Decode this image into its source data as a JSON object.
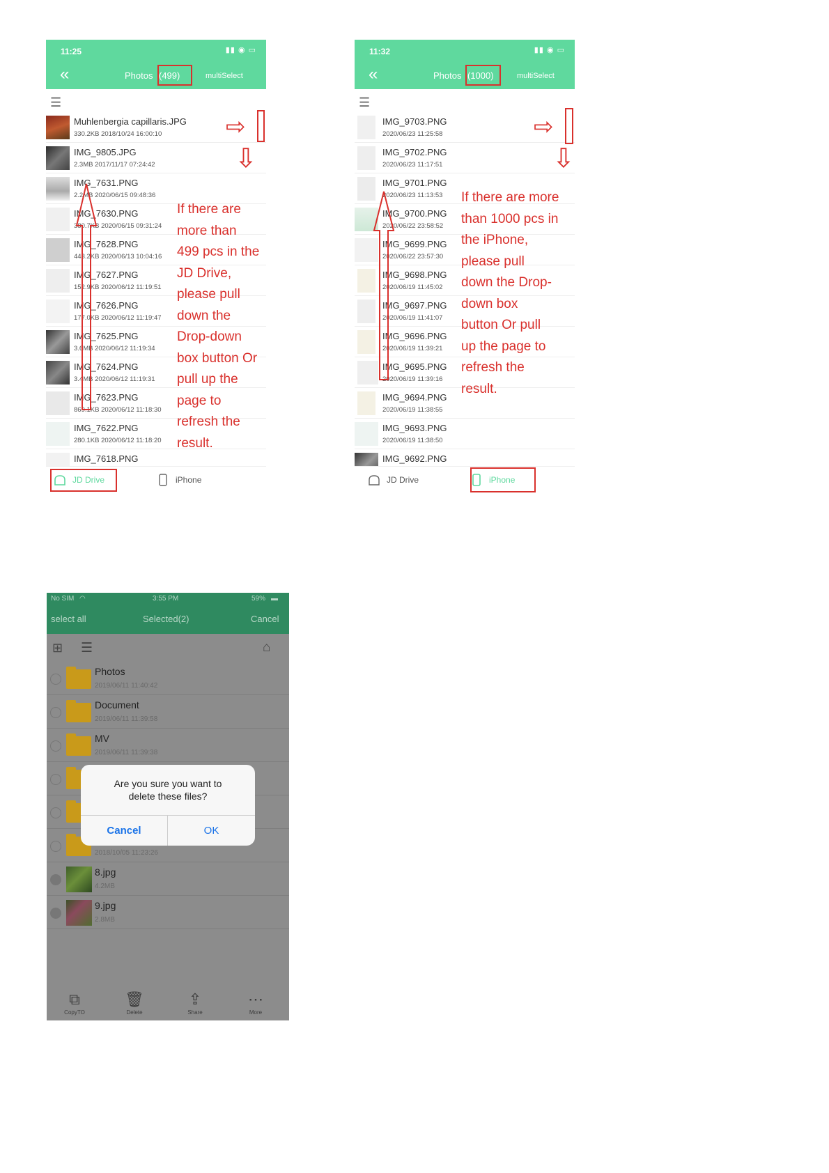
{
  "phone1": {
    "status_time": "11:25",
    "title": "Photos",
    "count": "(499)",
    "multiselect": "multiSelect",
    "files": [
      {
        "name": "Muhlenbergia capillaris.JPG",
        "meta": "330.2KB 2018/10/24 16:00:10"
      },
      {
        "name": "IMG_9805.JPG",
        "meta": "2.3MB 2017/11/17 07:24:42"
      },
      {
        "name": "IMG_7631.PNG",
        "meta": "2.2MB 2020/06/15 09:48:36"
      },
      {
        "name": "IMG_7630.PNG",
        "meta": "380.7KB 2020/06/15 09:31:24"
      },
      {
        "name": "IMG_7628.PNG",
        "meta": "443.2KB 2020/06/13 10:04:16"
      },
      {
        "name": "IMG_7627.PNG",
        "meta": "152.9KB 2020/06/12 11:19:51"
      },
      {
        "name": "IMG_7626.PNG",
        "meta": "177.0KB 2020/06/12 11:19:47"
      },
      {
        "name": "IMG_7625.PNG",
        "meta": "3.6MB 2020/06/12 11:19:34"
      },
      {
        "name": "IMG_7624.PNG",
        "meta": "3.4MB 2020/06/12 11:19:31"
      },
      {
        "name": "IMG_7623.PNG",
        "meta": "869.1KB 2020/06/12 11:18:30"
      },
      {
        "name": "IMG_7622.PNG",
        "meta": "280.1KB 2020/06/12 11:18:20"
      },
      {
        "name": "IMG_7618.PNG",
        "meta": ""
      }
    ],
    "tabs": {
      "jd_drive": "JD Drive",
      "iphone": "iPhone"
    },
    "annotation": [
      "If there are",
      "more than",
      "499 pcs in the",
      "JD Drive,",
      "please pull",
      "down the",
      "Drop-down",
      "box button Or",
      "pull up the",
      "page to",
      "refresh the",
      "result."
    ]
  },
  "phone2": {
    "status_time": "11:32",
    "title": "Photos",
    "count": "(1000)",
    "multiselect": "multiSelect",
    "files": [
      {
        "name": "IMG_9703.PNG",
        "meta": "2020/06/23 11:25:58"
      },
      {
        "name": "IMG_9702.PNG",
        "meta": "2020/06/23 11:17:51"
      },
      {
        "name": "IMG_9701.PNG",
        "meta": "2020/06/23 11:13:53"
      },
      {
        "name": "IMG_9700.PNG",
        "meta": "2020/06/22 23:58:52"
      },
      {
        "name": "IMG_9699.PNG",
        "meta": "2020/06/22 23:57:30"
      },
      {
        "name": "IMG_9698.PNG",
        "meta": "2020/06/19 11:45:02"
      },
      {
        "name": "IMG_9697.PNG",
        "meta": "2020/06/19 11:41:07"
      },
      {
        "name": "IMG_9696.PNG",
        "meta": "2020/06/19 11:39:21"
      },
      {
        "name": "IMG_9695.PNG",
        "meta": "2020/06/19 11:39:16"
      },
      {
        "name": "IMG_9694.PNG",
        "meta": "2020/06/19 11:38:55"
      },
      {
        "name": "IMG_9693.PNG",
        "meta": "2020/06/19 11:38:50"
      },
      {
        "name": "IMG_9692.PNG",
        "meta": ""
      }
    ],
    "tabs": {
      "jd_drive": "JD Drive",
      "iphone": "iPhone"
    },
    "annotation": [
      "If there are more",
      "than 1000 pcs in",
      "the iPhone,",
      "please pull",
      "down the Drop-",
      "down box",
      "button Or pull",
      "up the page to",
      "refresh the",
      "result."
    ]
  },
  "phone3": {
    "status_left": "No SIM",
    "status_time": "3:55 PM",
    "status_battery": "59%",
    "select_all": "select all",
    "selected": "Selected(2)",
    "cancel": "Cancel",
    "items": [
      {
        "name": "Photos",
        "meta": "2019/06/11 11:40:42",
        "kind": "folder",
        "checked": false
      },
      {
        "name": "Document",
        "meta": "2019/06/11 11:39:58",
        "kind": "folder",
        "checked": false
      },
      {
        "name": "MV",
        "meta": "2019/06/11 11:39:38",
        "kind": "folder",
        "checked": false
      },
      {
        "name": "",
        "meta": "",
        "kind": "folder",
        "checked": false
      },
      {
        "name": "",
        "meta": "",
        "kind": "folder",
        "checked": false
      },
      {
        "name": "",
        "meta": "2018/10/05 11:23:26",
        "kind": "folder",
        "checked": false
      },
      {
        "name": "8.jpg",
        "meta": "4.2MB",
        "kind": "image",
        "checked": true
      },
      {
        "name": "9.jpg",
        "meta": "2.8MB",
        "kind": "image",
        "checked": true
      }
    ],
    "dialog": {
      "message_line1": "Are you sure you want to",
      "message_line2": "delete these files?",
      "cancel": "Cancel",
      "ok": "OK"
    },
    "bottom": {
      "copyto": "CopyTO",
      "delete": "Delete",
      "share": "Share",
      "more": "More"
    }
  },
  "colors": {
    "header_green": "#5fd99e",
    "dark_green": "#2f8a60",
    "annotation_red": "#d9302c",
    "ios_blue": "#1a73e8",
    "folder_yellow": "#c99a1a"
  }
}
